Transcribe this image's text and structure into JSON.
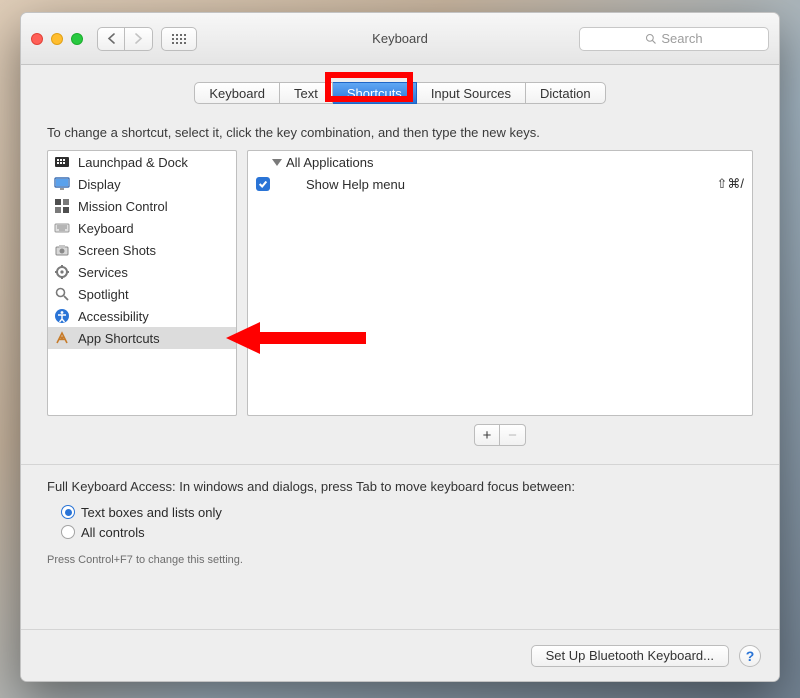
{
  "window": {
    "title": "Keyboard"
  },
  "search": {
    "placeholder": "Search"
  },
  "tabs": [
    {
      "label": "Keyboard"
    },
    {
      "label": "Text"
    },
    {
      "label": "Shortcuts",
      "selected": true
    },
    {
      "label": "Input Sources"
    },
    {
      "label": "Dictation"
    }
  ],
  "instructions": "To change a shortcut, select it, click the key combination, and then type the new keys.",
  "categories": [
    {
      "label": "Launchpad & Dock",
      "icon": "launchpad"
    },
    {
      "label": "Display",
      "icon": "display"
    },
    {
      "label": "Mission Control",
      "icon": "mission"
    },
    {
      "label": "Keyboard",
      "icon": "keyboard"
    },
    {
      "label": "Screen Shots",
      "icon": "screenshots"
    },
    {
      "label": "Services",
      "icon": "services"
    },
    {
      "label": "Spotlight",
      "icon": "spotlight"
    },
    {
      "label": "Accessibility",
      "icon": "accessibility"
    },
    {
      "label": "App Shortcuts",
      "icon": "appshortcuts",
      "selected": true
    }
  ],
  "details": {
    "group_label": "All Applications",
    "items": [
      {
        "enabled": true,
        "label": "Show Help menu",
        "shortcut": "⇧⌘/"
      }
    ]
  },
  "buttons": {
    "add": "+",
    "remove": "−"
  },
  "fka": {
    "heading": "Full Keyboard Access: In windows and dialogs, press Tab to move keyboard focus between:",
    "opt1": "Text boxes and lists only",
    "opt2": "All controls",
    "hint": "Press Control+F7 to change this setting."
  },
  "footer": {
    "bluetooth": "Set Up Bluetooth Keyboard...",
    "help": "?"
  },
  "annotations": {
    "highlight_tab": "Shortcuts",
    "arrow_target": "App Shortcuts",
    "colors": {
      "emphasis": "#ff0000",
      "accent": "#2a74d6"
    }
  }
}
